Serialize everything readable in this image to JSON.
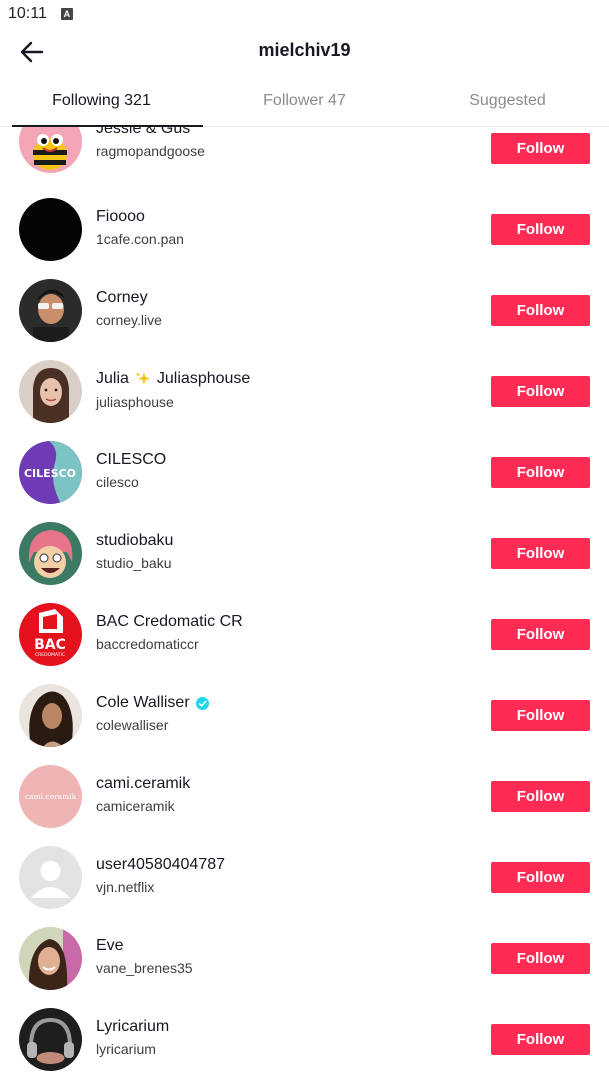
{
  "status": {
    "time": "10:11",
    "icon_letter": "A"
  },
  "header": {
    "title": "mielchiv19"
  },
  "tabs": [
    {
      "label": "Following 321",
      "active": true
    },
    {
      "label": "Follower 47",
      "active": false
    },
    {
      "label": "Suggested",
      "active": false
    }
  ],
  "follow_label": "Follow",
  "users": [
    {
      "name": "Jessie & Gus",
      "handle": "ragmopandgoose"
    },
    {
      "name": "Fioooo",
      "handle": "1cafe.con.pan"
    },
    {
      "name": "Corney",
      "handle": "corney.live"
    },
    {
      "name": "Julia",
      "name_suffix": "Juliasphouse",
      "handle": "juliasphouse"
    },
    {
      "name": "CILESCO",
      "handle": "cilesco",
      "avatar_text": "CILESCO"
    },
    {
      "name": "studiobaku",
      "handle": "studio_baku"
    },
    {
      "name": "BAC Credomatic CR",
      "handle": "baccredomaticcr",
      "avatar_text": "BAC",
      "avatar_subtext": "CREDOMATIC"
    },
    {
      "name": "Cole Walliser",
      "handle": "colewalliser",
      "verified": true
    },
    {
      "name": "cami.ceramik",
      "handle": "camiceramik",
      "avatar_text": "cami.ceramik"
    },
    {
      "name": "user40580404787",
      "handle": "vjn.netflix"
    },
    {
      "name": "Eve",
      "handle": "vane_brenes35"
    },
    {
      "name": "Lyricarium",
      "handle": "lyricarium"
    }
  ],
  "colors": {
    "follow": "#fe2c55",
    "verified": "#20d5ec"
  }
}
